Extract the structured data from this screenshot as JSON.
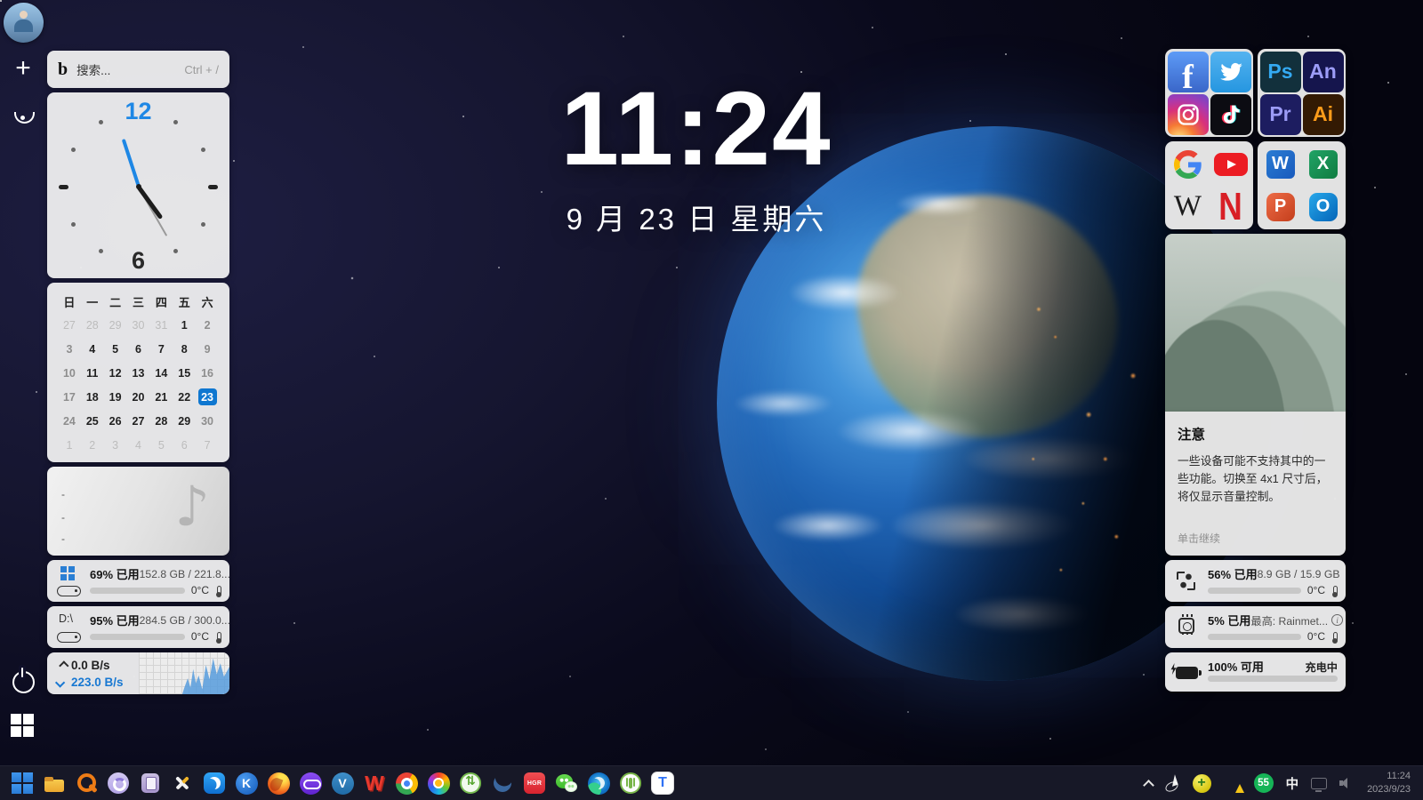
{
  "main_clock": {
    "time": "11:24",
    "date": "9 月 23 日 星期六"
  },
  "search": {
    "placeholder": "搜索...",
    "shortcut": "Ctrl + /"
  },
  "analog_clock": {
    "twelve": "12",
    "six": "6"
  },
  "calendar": {
    "headers": [
      "日",
      "一",
      "二",
      "三",
      "四",
      "五",
      "六"
    ],
    "cells": [
      {
        "d": "27",
        "s": "dim"
      },
      {
        "d": "28",
        "s": "dim"
      },
      {
        "d": "29",
        "s": "dim"
      },
      {
        "d": "30",
        "s": "dim"
      },
      {
        "d": "31",
        "s": "dim"
      },
      {
        "d": "1",
        "s": "on"
      },
      {
        "d": "2",
        "s": "wk"
      },
      {
        "d": "3",
        "s": "wk"
      },
      {
        "d": "4",
        "s": "on"
      },
      {
        "d": "5",
        "s": "on"
      },
      {
        "d": "6",
        "s": "on"
      },
      {
        "d": "7",
        "s": "on"
      },
      {
        "d": "8",
        "s": "on"
      },
      {
        "d": "9",
        "s": "wk"
      },
      {
        "d": "10",
        "s": "wk"
      },
      {
        "d": "11",
        "s": "on"
      },
      {
        "d": "12",
        "s": "on"
      },
      {
        "d": "13",
        "s": "on"
      },
      {
        "d": "14",
        "s": "on"
      },
      {
        "d": "15",
        "s": "on"
      },
      {
        "d": "16",
        "s": "wk"
      },
      {
        "d": "17",
        "s": "wk"
      },
      {
        "d": "18",
        "s": "on"
      },
      {
        "d": "19",
        "s": "on"
      },
      {
        "d": "20",
        "s": "on"
      },
      {
        "d": "21",
        "s": "on"
      },
      {
        "d": "22",
        "s": "on"
      },
      {
        "d": "23",
        "s": "sel"
      },
      {
        "d": "24",
        "s": "wk"
      },
      {
        "d": "25",
        "s": "on"
      },
      {
        "d": "26",
        "s": "on"
      },
      {
        "d": "27",
        "s": "on"
      },
      {
        "d": "28",
        "s": "on"
      },
      {
        "d": "29",
        "s": "on"
      },
      {
        "d": "30",
        "s": "wk"
      },
      {
        "d": "1",
        "s": "dim"
      },
      {
        "d": "2",
        "s": "dim"
      },
      {
        "d": "3",
        "s": "dim"
      },
      {
        "d": "4",
        "s": "dim"
      },
      {
        "d": "5",
        "s": "dim"
      },
      {
        "d": "6",
        "s": "dim"
      },
      {
        "d": "7",
        "s": "dim"
      }
    ]
  },
  "music": {
    "line": "-"
  },
  "widgets": {
    "disk_c": {
      "percent": 69,
      "used_label": "69% 已用",
      "size_label": "152.8 GB / 221.8...",
      "temp": "0°C"
    },
    "disk_d": {
      "drive": "D:\\",
      "percent": 95,
      "used_label": "95% 已用",
      "size_label": "284.5 GB / 300.0...",
      "temp": "0°C"
    },
    "network": {
      "up": "0.0 B/s",
      "down": "223.0 B/s"
    },
    "ram": {
      "percent": 56,
      "used_label": "56% 已用",
      "size_label": "8.9 GB / 15.9 GB",
      "temp": "0°C"
    },
    "cpu": {
      "percent": 5,
      "used_label": "5% 已用",
      "top_label": "最高: Rainmet...",
      "temp": "0°C"
    },
    "battery": {
      "percent": 100,
      "avail_label": "100% 可用",
      "status": "充电中"
    }
  },
  "notice": {
    "title": "注意",
    "body": "一些设备可能不支持其中的一些功能。切换至 4x1 尺寸后，将仅显示音量控制。",
    "action": "单击继续"
  },
  "shortcuts": {
    "social": [
      {
        "name": "facebook",
        "label": "f"
      },
      {
        "name": "twitter",
        "label": ""
      },
      {
        "name": "instagram",
        "label": ""
      },
      {
        "name": "tiktok",
        "label": ""
      }
    ],
    "adobe": [
      {
        "name": "photoshop",
        "label": "Ps"
      },
      {
        "name": "animate",
        "label": "An"
      },
      {
        "name": "premiere",
        "label": "Pr"
      },
      {
        "name": "illustrator",
        "label": "Ai"
      }
    ],
    "web": [
      {
        "name": "google",
        "label": ""
      },
      {
        "name": "youtube",
        "label": ""
      },
      {
        "name": "wikipedia",
        "label": "W"
      },
      {
        "name": "netflix",
        "label": "N"
      }
    ],
    "office": [
      {
        "name": "word",
        "label": "W"
      },
      {
        "name": "excel",
        "label": "X"
      },
      {
        "name": "powerpoint",
        "label": "P"
      },
      {
        "name": "outlook",
        "label": "O"
      }
    ]
  },
  "taskbar": {
    "icons": [
      {
        "name": "windows-start",
        "glyph": ""
      },
      {
        "name": "file-explorer",
        "glyph": ""
      },
      {
        "name": "orange-search",
        "glyph": ""
      },
      {
        "name": "purple-ring-app",
        "glyph": ""
      },
      {
        "name": "clipboard-app",
        "glyph": ""
      },
      {
        "name": "cross-tools-app",
        "glyph": ""
      },
      {
        "name": "blue-cat-app",
        "glyph": ""
      },
      {
        "name": "keepass",
        "glyph": "K"
      },
      {
        "name": "firefox",
        "glyph": ""
      },
      {
        "name": "purple-glasses-app",
        "glyph": ""
      },
      {
        "name": "v2rayn",
        "glyph": "V"
      },
      {
        "name": "wps-office",
        "glyph": "W"
      },
      {
        "name": "chrome",
        "glyph": ""
      },
      {
        "name": "color-wheel-app",
        "glyph": ""
      },
      {
        "name": "green-sync-app",
        "glyph": ""
      },
      {
        "name": "blue-swoosh-app",
        "glyph": ""
      },
      {
        "name": "red-box-app",
        "glyph": "HGR"
      },
      {
        "name": "wechat",
        "glyph": ""
      },
      {
        "name": "edge",
        "glyph": ""
      },
      {
        "name": "green-ring-app",
        "glyph": ""
      },
      {
        "name": "tencent-meeting",
        "glyph": "T"
      }
    ]
  },
  "tray": {
    "icon_names": [
      "tray-chevron-up",
      "cursor-tray",
      "plus-ball-tray",
      "defender-shield",
      "temp-badge",
      "ime-indicator",
      "monitor-tray",
      "speaker-tray"
    ],
    "ime": "中",
    "badge": "55",
    "time": "11:24",
    "date": "2023/9/23"
  },
  "rail": {
    "icon_names": [
      "avatar",
      "add",
      "eye",
      "power",
      "windows-flag"
    ]
  }
}
